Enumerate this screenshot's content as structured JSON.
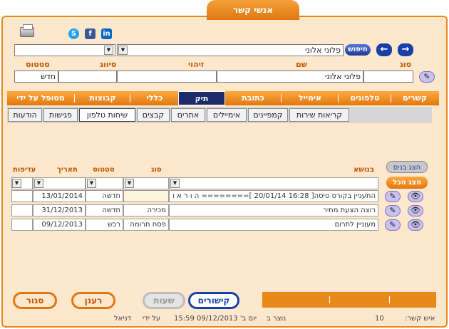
{
  "window": {
    "title": "אנשי קשר"
  },
  "social": {
    "skype": "S",
    "facebook": "f",
    "linkedin": "in"
  },
  "search": {
    "button_label": "חיפוש",
    "contact_value": "פלוני אלוני",
    "secondary_value": ""
  },
  "labels": {
    "type": "סוג",
    "name": "שם",
    "id": "זיהוי",
    "classification": "סיווג",
    "status": "סטטוס"
  },
  "fields": {
    "type": "",
    "name": "פלוני אלוני",
    "id": "",
    "classification": "",
    "status": "חדש"
  },
  "tabs": [
    "קשרים",
    "טלפונים",
    "אימייל",
    "כתובת",
    "תיק",
    "כללי",
    "קבוצות",
    "מטופל על ידי"
  ],
  "subtabs": [
    "קריאות שירות",
    "קמפיינים",
    "אימיילים",
    "אתרים",
    "קבצים",
    "שיחות טלפון",
    "פגישות",
    "הודעות"
  ],
  "actions": {
    "show_children": "הצג בנים",
    "show_all": "הצג הכל"
  },
  "table": {
    "headers": {
      "subject": "בנושא",
      "type": "סוג",
      "status": "סטטוס",
      "date": "תאריך",
      "priority": "עדיפות"
    },
    "rows": [
      {
        "subject": "התעניין בקורס טיסה[ 16:28 20/01/14 ]======== ה ו ר א ו",
        "type": "",
        "status": "חדשה",
        "date": "13/01/2014",
        "priority": ""
      },
      {
        "subject": "רוצה הצעת מחיר",
        "type": "מכירה",
        "status": "חדשה",
        "date": "31/12/2013",
        "priority": ""
      },
      {
        "subject": "מעוניין לתרום",
        "type": "פסח תרומה",
        "status": "רכש",
        "date": "09/12/2013",
        "priority": ""
      }
    ]
  },
  "buttons": {
    "links": "קישורים",
    "hours": "שעות",
    "refresh": "רענן",
    "close": "סגור"
  },
  "footer": {
    "contact_label": "איש קשר:",
    "contact_value": "10",
    "created_label": "נוצר ב",
    "created_value": "יום ב' 09/12/2013 15:59",
    "by_label": "על ידי",
    "by_value": "דניאל"
  },
  "colors": {
    "accent": "#e88a1a",
    "panel": "#fde7cd",
    "nav_blue": "#1a3fa8",
    "active_tab": "#1a2a6a"
  }
}
